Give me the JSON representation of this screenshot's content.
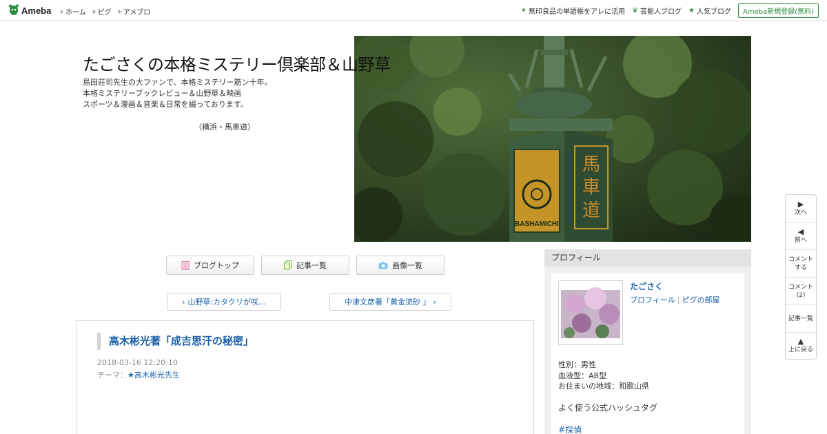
{
  "topbar": {
    "logo_text": "Ameba",
    "nav": [
      "ホーム",
      "ピグ",
      "アメブロ"
    ],
    "right_links": [
      {
        "icon": "sparkle-icon",
        "label": "無印良品の単語帳をアレに活用"
      },
      {
        "icon": "crown-icon",
        "label": "芸能人ブログ"
      },
      {
        "icon": "crown-icon",
        "label": "人気ブログ"
      }
    ],
    "signup_label": "Ameba新規登録(無料)"
  },
  "header": {
    "title": "たごさくの本格ミステリー倶楽部＆山野草",
    "description": [
      "島田荘司先生の大ファンで、本格ミステリー筋ン十年。",
      "本格ミステリーブックレビュー＆山野草＆映画",
      "スポーツ＆漫画＆音楽＆日常を綴っております。"
    ],
    "location": "（横浜・馬車道）",
    "hero_sign_text": "馬車道",
    "hero_sign_en": "BASHAMICHI"
  },
  "buttons": {
    "blog_top": "ブログトップ",
    "articles": "記事一覧",
    "images": "画像一覧"
  },
  "pager": {
    "prev": "山野草:カタクリが咲…",
    "next": "中津文彦著「黄金流砂 」"
  },
  "article": {
    "title": "高木彬光著「成吉思汗の秘密」",
    "date": "2018-03-16 12:20:10",
    "theme_label": "テーマ：",
    "theme": "★高木彬光先生"
  },
  "sidebar": {
    "header": "プロフィール",
    "name": "たごさく",
    "profile_link": "プロフィール",
    "pig_link": "ピグの部屋",
    "gender": "性別：男性",
    "blood": "血液型：AB型",
    "residence": "お住まいの地域：和歌山県",
    "hashtag_title": "よく使う公式ハッシュタグ",
    "hashtag": "#探偵"
  },
  "floatnav": {
    "next": "次へ",
    "prev": "前へ",
    "comment_1": "コメント",
    "comment_2": "する",
    "comments_1": "コメント",
    "comments_2": "(2)",
    "article_list": "記事一覧",
    "top_1": "上に戻る"
  },
  "colors": {
    "link": "#1a5fa8",
    "ameba_green": "#2d8a3e",
    "border": "#cccccc"
  }
}
